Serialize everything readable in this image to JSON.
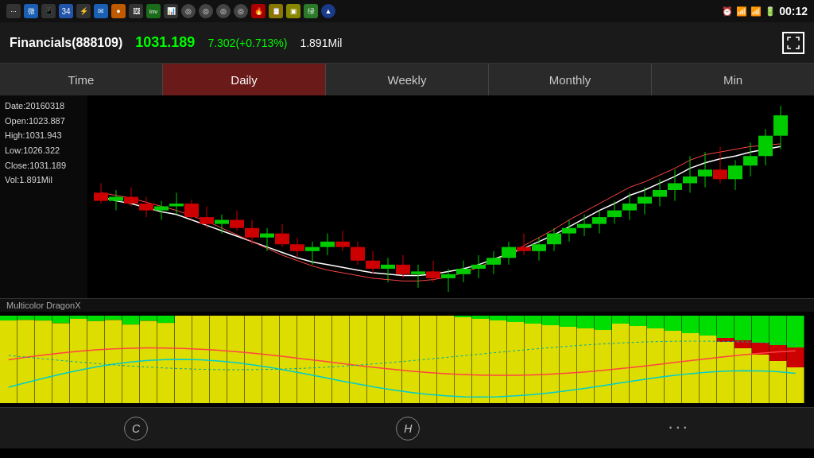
{
  "statusBar": {
    "time": "00:12",
    "icons": [
      "...",
      "✉",
      "📱",
      "34",
      "USB",
      "✉",
      "🟠",
      "📷",
      "Inv",
      "📊",
      "🌐",
      "🌐",
      "🌐",
      "🌐",
      "🌐",
      "🔴",
      "📋",
      "🟡",
      "🔺"
    ]
  },
  "header": {
    "title": "Financials(888109)",
    "price": "1031.189",
    "change": "7.302(+0.713%)",
    "volume": "1.891Mil"
  },
  "tabs": [
    {
      "label": "Time",
      "active": false
    },
    {
      "label": "Daily",
      "active": true
    },
    {
      "label": "Weekly",
      "active": false
    },
    {
      "label": "Monthly",
      "active": false
    },
    {
      "label": "Min",
      "active": false
    }
  ],
  "chartLabels": {
    "date": "Date:20160318",
    "open": "Open:1023.887",
    "high": "High:1031.943",
    "low": "Low:1026.322",
    "close": "Close:1031.189",
    "vol": "Vol:1.891Mil"
  },
  "indicatorLabel": "Multicolor DragonX",
  "bottomBar": {
    "cBtn": "C",
    "hBtn": "H",
    "moreLabel": "···"
  }
}
